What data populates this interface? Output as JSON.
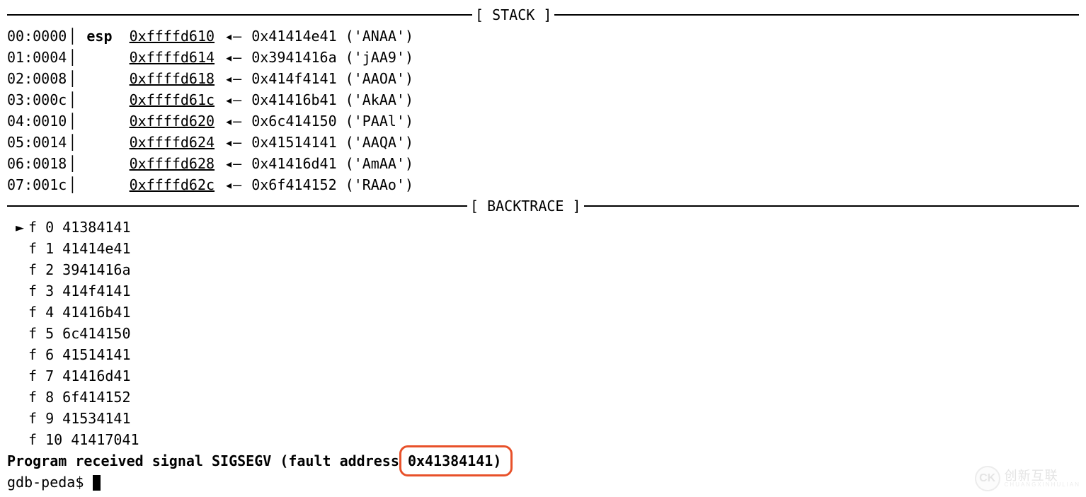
{
  "sections": {
    "stack_label": "[ STACK ]",
    "backtrace_label": "[ BACKTRACE ]"
  },
  "stack": [
    {
      "offset": "00:0000",
      "reg": "esp",
      "addr": "0xffffd610",
      "value": "0x41414e41",
      "ascii": "('ANAA')"
    },
    {
      "offset": "01:0004",
      "reg": "",
      "addr": "0xffffd614",
      "value": "0x3941416a",
      "ascii": "('jAA9')"
    },
    {
      "offset": "02:0008",
      "reg": "",
      "addr": "0xffffd618",
      "value": "0x414f4141",
      "ascii": "('AAOA')"
    },
    {
      "offset": "03:000c",
      "reg": "",
      "addr": "0xffffd61c",
      "value": "0x41416b41",
      "ascii": "('AkAA')"
    },
    {
      "offset": "04:0010",
      "reg": "",
      "addr": "0xffffd620",
      "value": "0x6c414150",
      "ascii": "('PAAl')"
    },
    {
      "offset": "05:0014",
      "reg": "",
      "addr": "0xffffd624",
      "value": "0x41514141",
      "ascii": "('AAQA')"
    },
    {
      "offset": "06:0018",
      "reg": "",
      "addr": "0xffffd628",
      "value": "0x41416d41",
      "ascii": "('AmAA')"
    },
    {
      "offset": "07:001c",
      "reg": "",
      "addr": "0xffffd62c",
      "value": "0x6f414152",
      "ascii": "('RAAo')"
    }
  ],
  "arrow_glyph": "◂—",
  "backtrace_pointer": "►",
  "backtrace": [
    {
      "active": true,
      "frame": "f 0",
      "addr": "41384141"
    },
    {
      "active": false,
      "frame": "f 1",
      "addr": "41414e41"
    },
    {
      "active": false,
      "frame": "f 2",
      "addr": "3941416a"
    },
    {
      "active": false,
      "frame": "f 3",
      "addr": "414f4141"
    },
    {
      "active": false,
      "frame": "f 4",
      "addr": "41416b41"
    },
    {
      "active": false,
      "frame": "f 5",
      "addr": "6c414150"
    },
    {
      "active": false,
      "frame": "f 6",
      "addr": "41514141"
    },
    {
      "active": false,
      "frame": "f 7",
      "addr": "41416d41"
    },
    {
      "active": false,
      "frame": "f 8",
      "addr": "6f414152"
    },
    {
      "active": false,
      "frame": "f 9",
      "addr": "41534141"
    },
    {
      "active": false,
      "frame": "f 10",
      "addr": "41417041"
    }
  ],
  "signal": {
    "prefix": "Program received signal SIGSEGV (fault address ",
    "fault_address": "0x41384141",
    "suffix": ")"
  },
  "prompt": "gdb-peda$ ",
  "watermark": {
    "badge": "CK",
    "main": "创新互联",
    "sub": "CHUANGXINHULIAN"
  }
}
